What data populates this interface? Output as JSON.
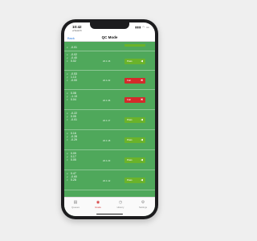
{
  "status_bar": {
    "time": "10:42",
    "carrier": "◂ Search",
    "signal_icon": "signal-icon",
    "wifi_icon": "wifi-icon",
    "battery_icon": "battery-icon"
  },
  "nav": {
    "back_label": "Back",
    "title": "QC Mode"
  },
  "colors": {
    "content_bg": "#4fa85b",
    "pass": "#6bb32a",
    "fail": "#d42a2a",
    "tab_active": "#d43a3a"
  },
  "rows": [
    {
      "values": [
        {
          "label": "x:",
          "value": "-0.01"
        }
      ],
      "timestamp": "",
      "status": "pass",
      "status_label": ""
    },
    {
      "values": [
        {
          "label": "x:",
          "value": "-0.02"
        },
        {
          "label": "y:",
          "value": "-0.40"
        },
        {
          "label": "z:",
          "value": "0.02"
        }
      ],
      "timestamp": "22.1.16",
      "status": "pass",
      "status_label": "Pass"
    },
    {
      "values": [
        {
          "label": "x:",
          "value": "-0.53"
        },
        {
          "label": "y:",
          "value": "1.13"
        },
        {
          "label": "z:",
          "value": "-0.00"
        }
      ],
      "timestamp": "22.1.22",
      "status": "fail",
      "status_label": "Fail"
    },
    {
      "values": [
        {
          "label": "x:",
          "value": "0.08"
        },
        {
          "label": "y:",
          "value": "-1.13"
        },
        {
          "label": "z:",
          "value": "0.04"
        }
      ],
      "timestamp": "22.1.36",
      "status": "fail",
      "status_label": "Fail"
    },
    {
      "values": [
        {
          "label": "x:",
          "value": "-0.22"
        },
        {
          "label": "y:",
          "value": "0.05"
        },
        {
          "label": "z:",
          "value": "-0.01"
        }
      ],
      "timestamp": "22.1.17",
      "status": "pass",
      "status_label": "Pass"
    },
    {
      "values": [
        {
          "label": "x:",
          "value": "0.16"
        },
        {
          "label": "y:",
          "value": "-0.28"
        },
        {
          "label": "z:",
          "value": "-0.29"
        }
      ],
      "timestamp": "22.1.18",
      "status": "pass",
      "status_label": "Pass"
    },
    {
      "values": [
        {
          "label": "x:",
          "value": "0.09"
        },
        {
          "label": "y:",
          "value": "0.17"
        },
        {
          "label": "z:",
          "value": "0.05"
        }
      ],
      "timestamp": "22.1.23",
      "status": "pass",
      "status_label": "Pass"
    },
    {
      "values": [
        {
          "label": "x:",
          "value": "0.47"
        },
        {
          "label": "y:",
          "value": "-0.60"
        },
        {
          "label": "z:",
          "value": "0.28"
        }
      ],
      "timestamp": "22.1.12",
      "status": "pass",
      "status_label": "Pass"
    }
  ],
  "footer_text": "Standard",
  "tabs": [
    {
      "label": "Queues",
      "icon": "queue-icon",
      "active": false
    },
    {
      "label": "Grade",
      "icon": "grade-icon",
      "active": true
    },
    {
      "label": "History",
      "icon": "history-icon",
      "active": false
    },
    {
      "label": "Settings",
      "icon": "settings-icon",
      "active": false
    }
  ]
}
